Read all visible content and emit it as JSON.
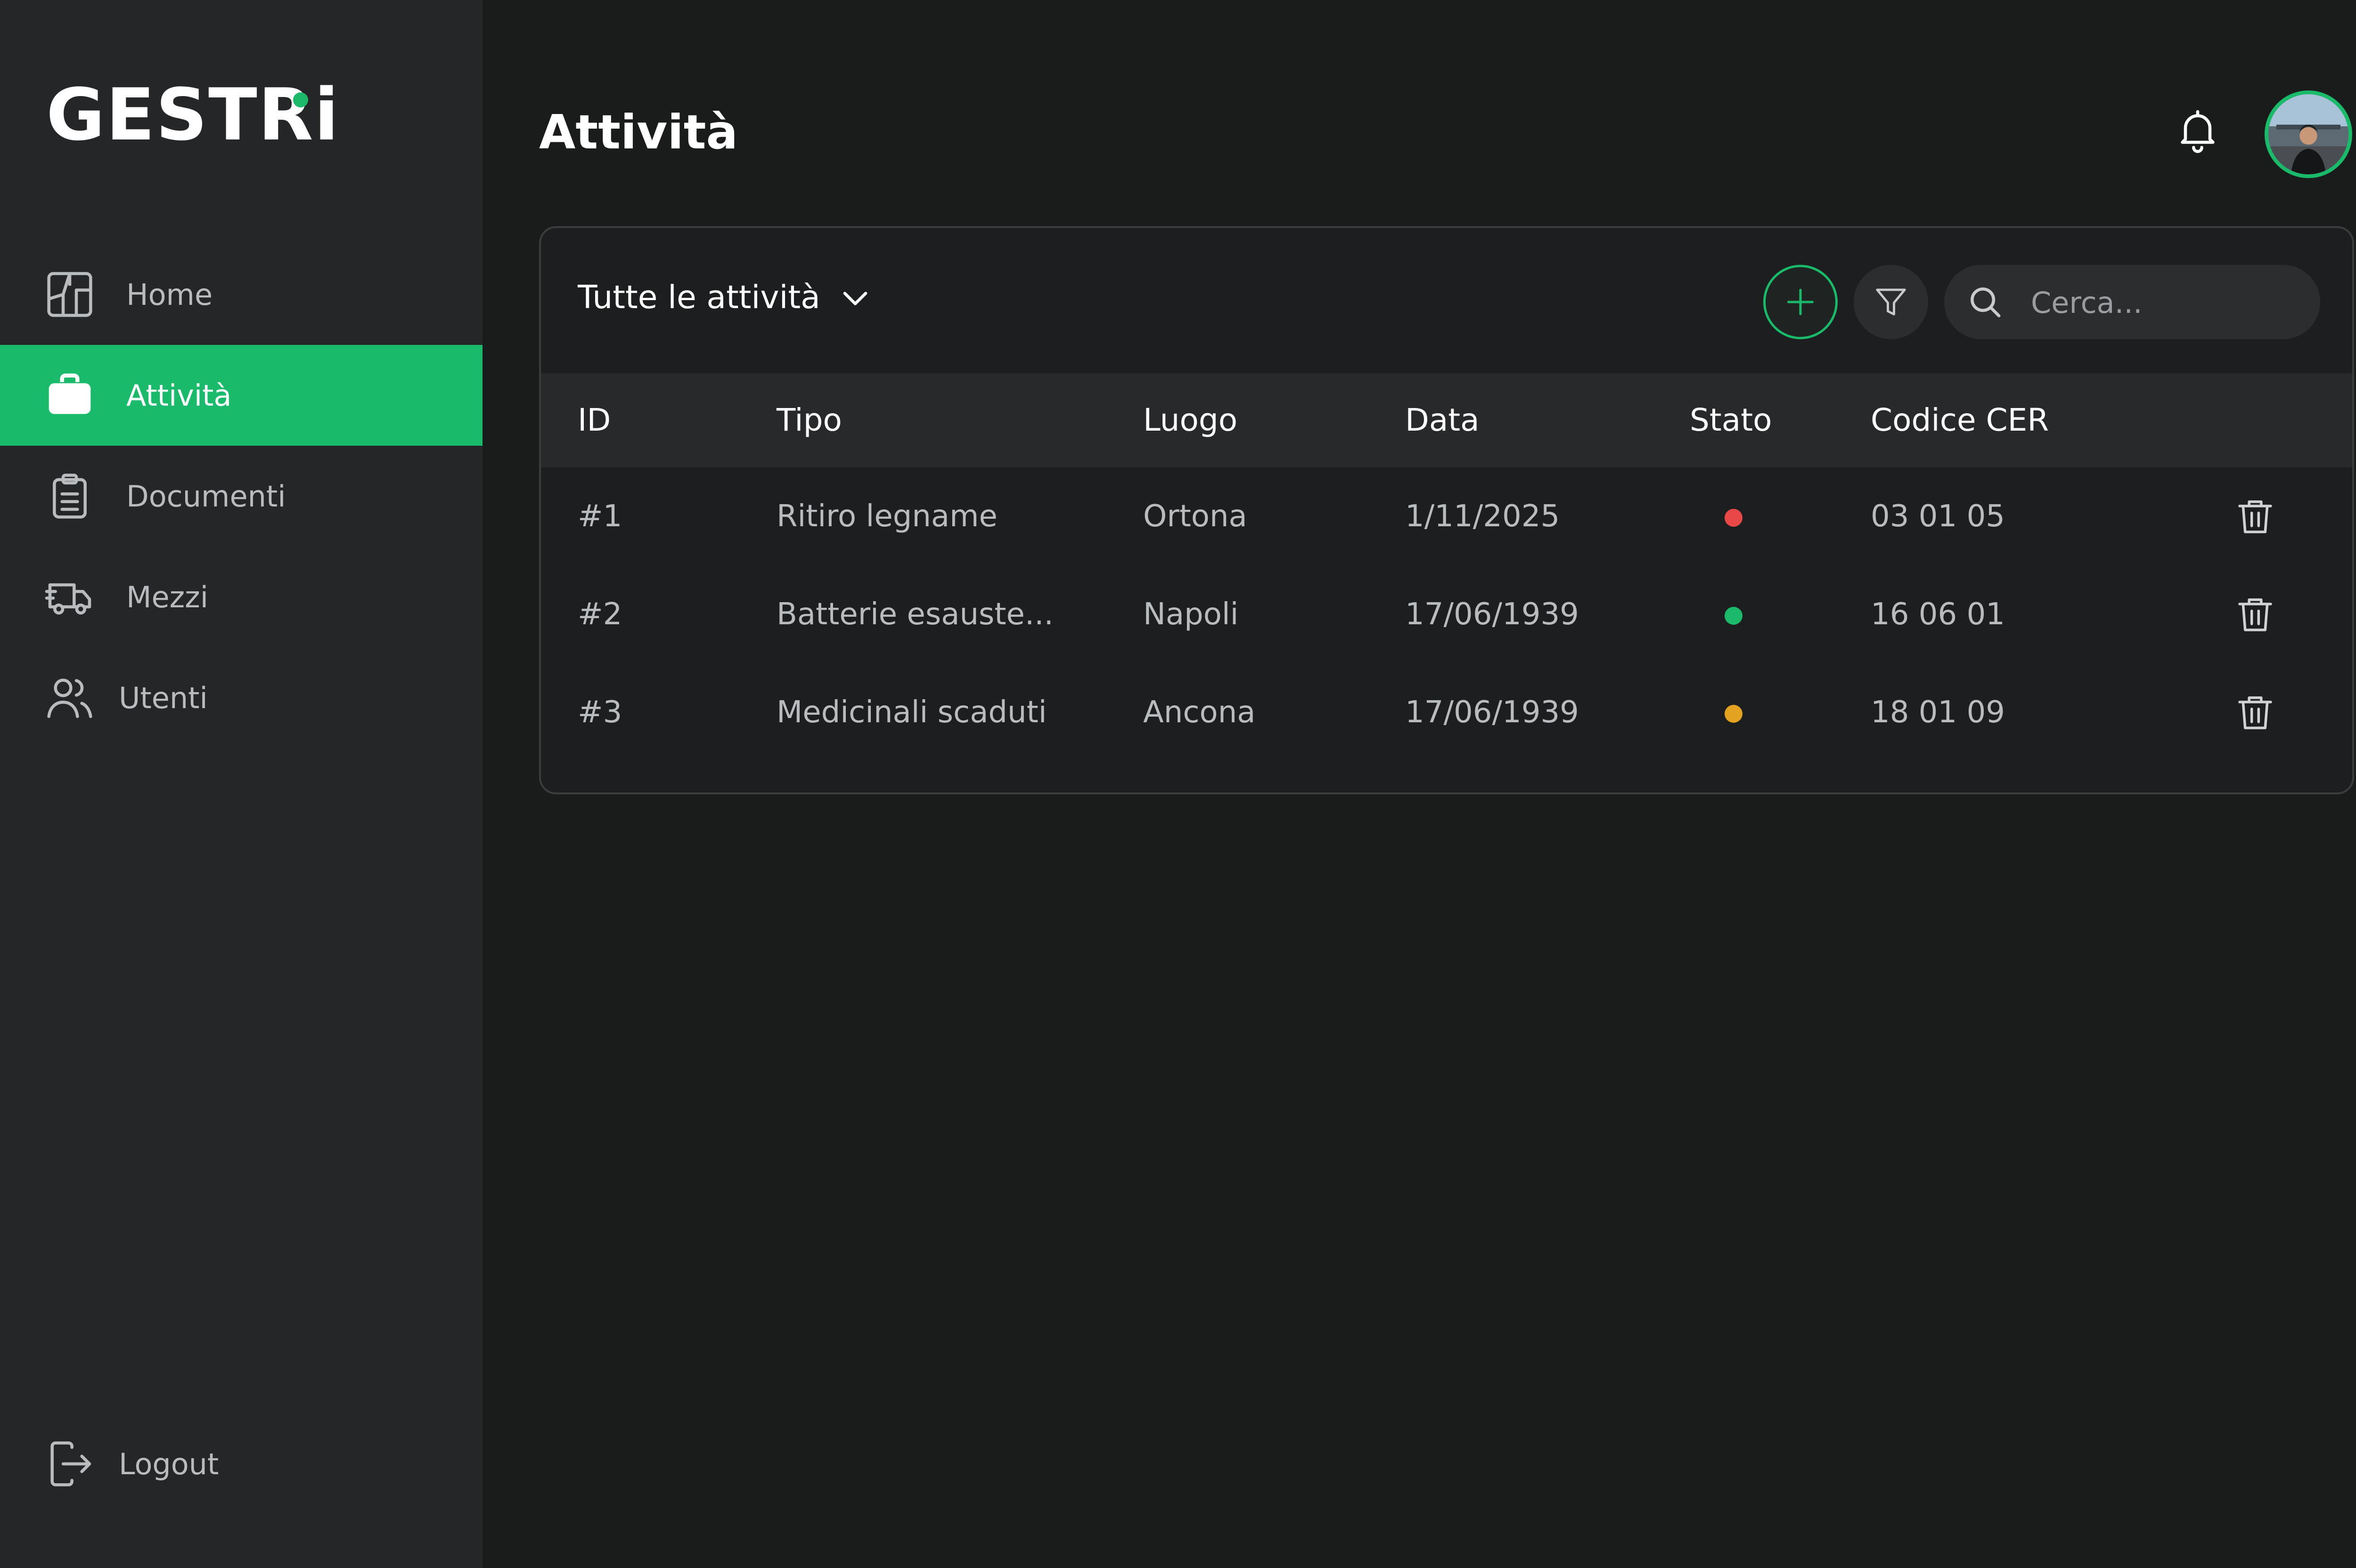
{
  "app": {
    "logo": "GESTRi",
    "accent": "#19bb6a"
  },
  "sidebar": {
    "items": [
      {
        "label": "Home",
        "icon": "home-layout-icon",
        "active": false
      },
      {
        "label": "Attività",
        "icon": "briefcase-icon",
        "active": true
      },
      {
        "label": "Documenti",
        "icon": "clipboard-icon",
        "active": false
      },
      {
        "label": "Mezzi",
        "icon": "truck-icon",
        "active": false
      },
      {
        "label": "Utenti",
        "icon": "users-icon",
        "active": false
      }
    ],
    "logout": {
      "label": "Logout",
      "icon": "logout-icon"
    }
  },
  "header": {
    "title": "Attività"
  },
  "toolbar": {
    "filter_label": "Tutte le attività",
    "search_placeholder": "Cerca..."
  },
  "table": {
    "columns": [
      "ID",
      "Tipo",
      "Luogo",
      "Data",
      "Stato",
      "Codice CER"
    ],
    "rows": [
      {
        "id": "#1",
        "tipo": "Ritiro legname",
        "luogo": "Ortona",
        "data": "1/11/2025",
        "stato": "red",
        "stato_color": "#e84848",
        "cer": "03 01 05"
      },
      {
        "id": "#2",
        "tipo": "Batterie esauste...",
        "luogo": "Napoli",
        "data": "17/06/1939",
        "stato": "green",
        "stato_color": "#1db96a",
        "cer": "16 06 01"
      },
      {
        "id": "#3",
        "tipo": "Medicinali scaduti",
        "luogo": "Ancona",
        "data": "17/06/1939",
        "stato": "orange",
        "stato_color": "#e3a21f",
        "cer": "18 01 09"
      }
    ]
  }
}
